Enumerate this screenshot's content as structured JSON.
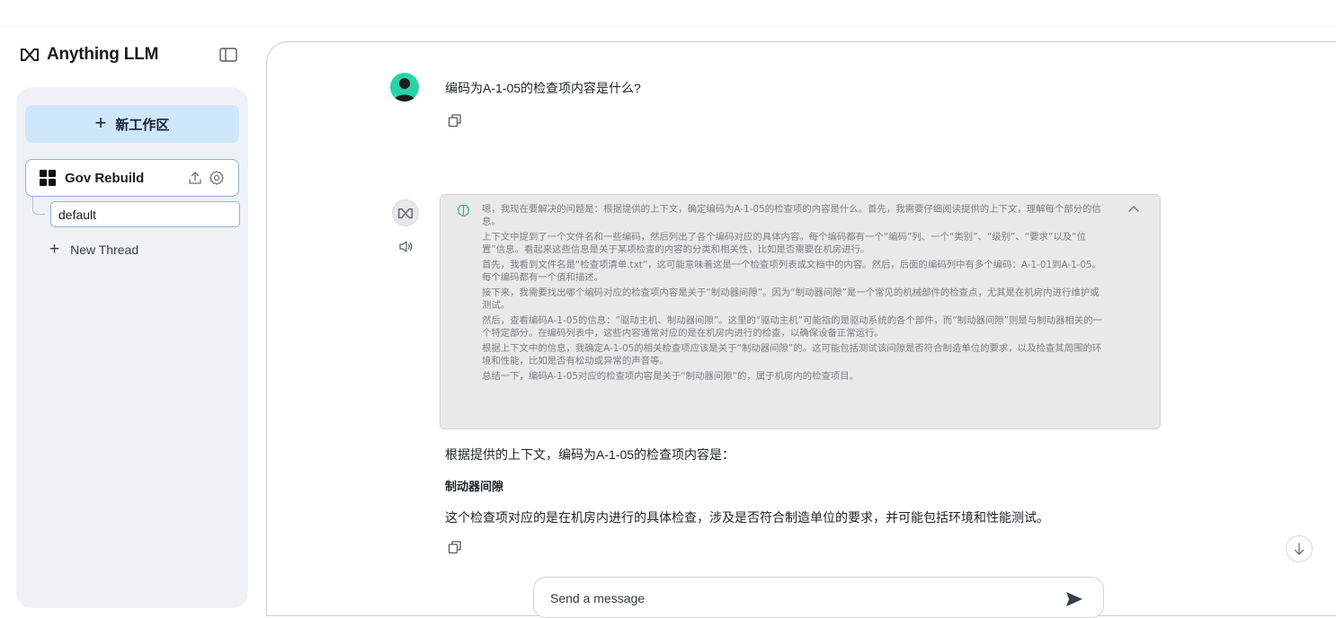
{
  "app": {
    "name": "Anything LLM"
  },
  "sidebar": {
    "new_workspace_label": "新工作区",
    "workspace": {
      "name": "Gov Rebuild"
    },
    "threads": [
      {
        "label": "default"
      }
    ],
    "new_thread_label": "New Thread"
  },
  "chat": {
    "user_message": "编码为A-1-05的检查项内容是什么?",
    "thinking": [
      "嗯，我现在要解决的问题是：根据提供的上下文，确定编码为A-1-05的检查项的内容是什么。首先，我需要仔细阅读提供的上下文，理解每个部分的信息。",
      "上下文中提到了一个文件名和一些编码，然后列出了各个编码对应的具体内容。每个编码都有一个“编码”列、一个“类别”、“级别”、“要求”以及“位置”信息。看起来这些信息是关于某项检查的内容的分类和相关性，比如是否需要在机房进行。",
      "首先，我看到文件名是“检查项清单.txt”，这可能意味着这是一个检查项列表或文档中的内容。然后，后面的编码列中有多个编码：A-1-01到A-1-05。每个编码都有一个值和描述。",
      "接下来，我需要找出哪个编码对应的检查项内容是关于“制动器间隙”。因为“制动器间隙”是一个常见的机械部件的检查点，尤其是在机房内进行维护或测试。",
      "然后，查看编码A-1-05的信息：“驱动主机、制动器间隙”。这里的“驱动主机”可能指的是驱动系统的各个部件，而“制动器间隙”则是与制动器相关的一个特定部分。在编码列表中，这些内容通常对应的是在机房内进行的检查，以确保设备正常运行。",
      "根据上下文中的信息，我确定A-1-05的相关检查项应该是关于“制动器间隙”的。这可能包括测试该间隙是否符合制造单位的要求，以及检查其周围的环境和性能，比如是否有松动或异常的声音等。",
      "总结一下，编码A-1-05对应的检查项内容是关于“制动器间隙”的，属于机房内的检查项目。"
    ],
    "answer_intro": "根据提供的上下文，编码为A-1-05的检查项内容是：",
    "answer_heading": "制动器间隙",
    "answer_body": "这个检查项对应的是在机房内进行的具体检查，涉及是否符合制造单位的要求，并可能包括环境和性能测试。"
  },
  "composer": {
    "placeholder": "Send a message"
  },
  "icons": {
    "brand": "anythingllm-logo-icon",
    "sidebar_toggle": "sidebar-toggle-icon",
    "workspace": "workspace-grid-icon",
    "upload": "upload-icon",
    "settings": "gear-icon",
    "copy": "copy-icon",
    "speaker": "speaker-icon",
    "thinking": "brain-icon",
    "collapse": "chevron-up-icon",
    "scroll_down": "arrow-down-icon",
    "send": "send-icon"
  },
  "colors": {
    "new_workspace_bg": "#cfe7fa",
    "sidebar_bg": "#eef2f7",
    "user_avatar": "#28d3a8",
    "thinking_bg": "#e9e9e9"
  }
}
